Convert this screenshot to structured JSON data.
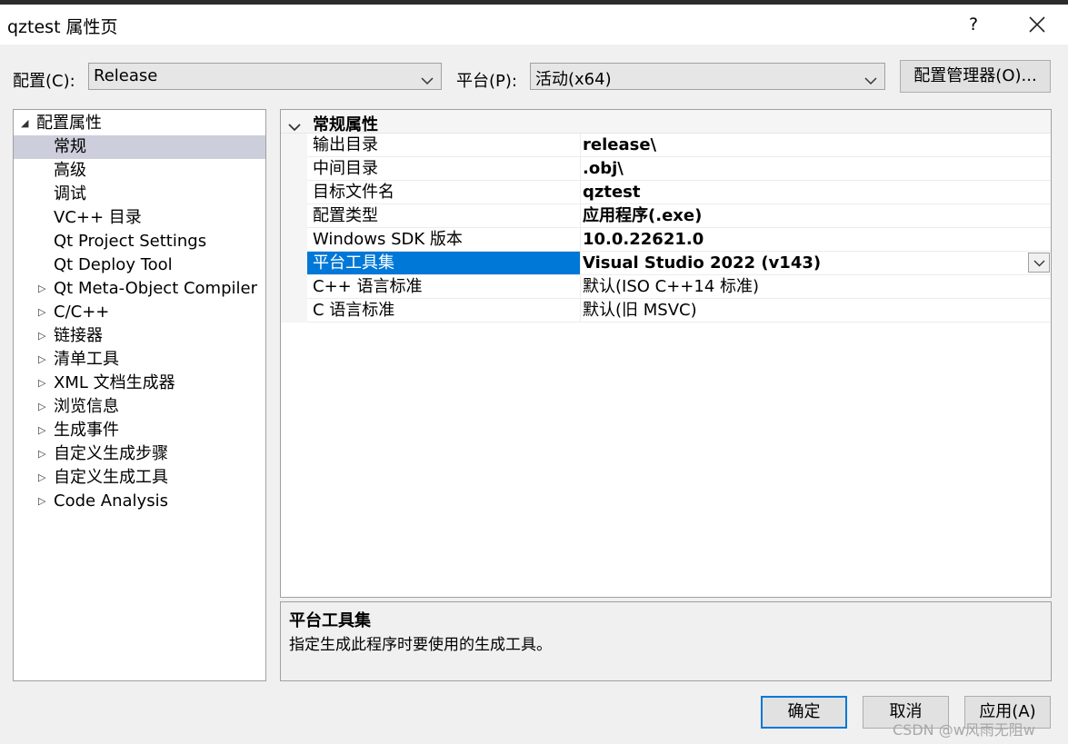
{
  "window": {
    "title": "qztest 属性页",
    "help_label": "?"
  },
  "config": {
    "label": "配置(C):",
    "value": "Release"
  },
  "platform": {
    "label": "平台(P):",
    "value": "活动(x64)"
  },
  "config_manager_label": "配置管理器(O)...",
  "tree": {
    "root_label": "配置属性",
    "items": [
      {
        "label": "常规",
        "expandable": false,
        "selected": true
      },
      {
        "label": "高级",
        "expandable": false
      },
      {
        "label": "调试",
        "expandable": false
      },
      {
        "label": "VC++ 目录",
        "expandable": false
      },
      {
        "label": "Qt Project Settings",
        "expandable": false
      },
      {
        "label": "Qt Deploy Tool",
        "expandable": false
      },
      {
        "label": "Qt Meta-Object Compiler",
        "expandable": true
      },
      {
        "label": "C/C++",
        "expandable": true
      },
      {
        "label": "链接器",
        "expandable": true
      },
      {
        "label": "清单工具",
        "expandable": true
      },
      {
        "label": "XML 文档生成器",
        "expandable": true
      },
      {
        "label": "浏览信息",
        "expandable": true
      },
      {
        "label": "生成事件",
        "expandable": true
      },
      {
        "label": "自定义生成步骤",
        "expandable": true
      },
      {
        "label": "自定义生成工具",
        "expandable": true
      },
      {
        "label": "Code Analysis",
        "expandable": true
      }
    ]
  },
  "grid": {
    "section_title": "常规属性",
    "rows": [
      {
        "name": "输出目录",
        "value": "release\\",
        "bold": true
      },
      {
        "name": "中间目录",
        "value": ".obj\\",
        "bold": true
      },
      {
        "name": "目标文件名",
        "value": "qztest",
        "bold": true
      },
      {
        "name": "配置类型",
        "value": "应用程序(.exe)",
        "bold": true
      },
      {
        "name": "Windows SDK 版本",
        "value": "10.0.22621.0",
        "bold": true
      },
      {
        "name": "平台工具集",
        "value": "Visual Studio 2022 (v143)",
        "bold": true,
        "selected": true
      },
      {
        "name": "C++ 语言标准",
        "value": "默认(ISO C++14 标准)",
        "bold": false
      },
      {
        "name": "C 语言标准",
        "value": "默认(旧 MSVC)",
        "bold": false
      }
    ]
  },
  "description": {
    "title": "平台工具集",
    "text": "指定生成此程序时要使用的生成工具。"
  },
  "buttons": {
    "ok": "确定",
    "cancel": "取消",
    "apply": "应用(A)"
  },
  "watermark": "CSDN @w风雨无阻w",
  "colors": {
    "selection": "#0078d7",
    "tree_selection": "#cccedb"
  }
}
